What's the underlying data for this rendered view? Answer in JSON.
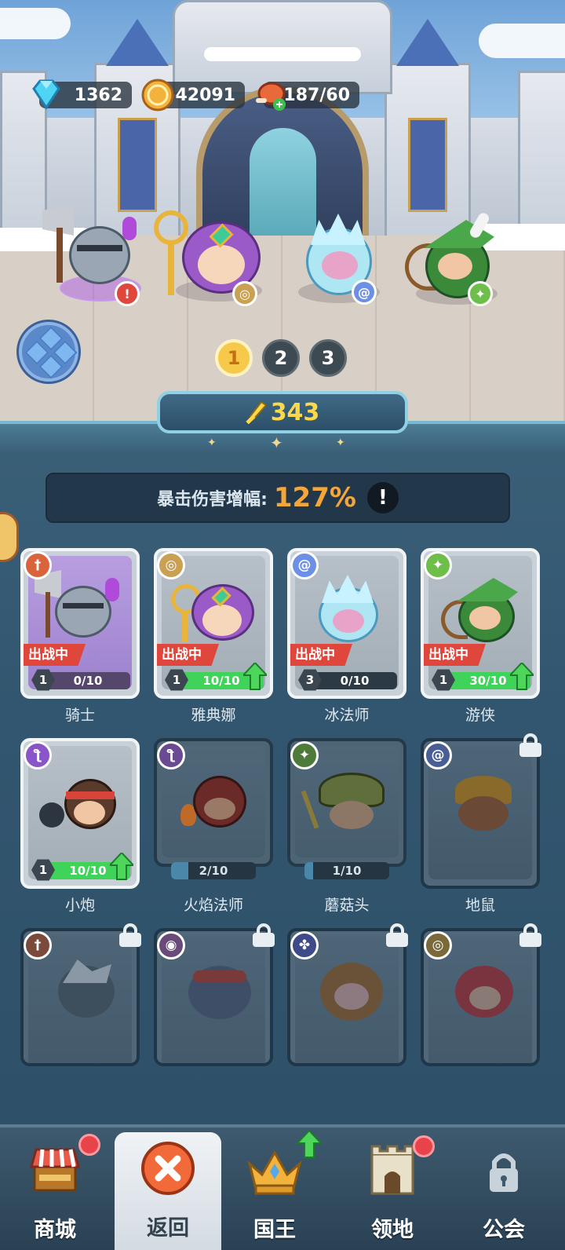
{
  "resources": {
    "gems": "1362",
    "gold": "42091",
    "stamina": "187/60"
  },
  "team_pages": [
    "1",
    "2",
    "3"
  ],
  "active_page": "1",
  "power": "343",
  "crit": {
    "label": "暴击伤害增幅:",
    "value": "127%",
    "info": "!"
  },
  "deploy_tag": "出战中",
  "heroes": [
    {
      "name": "骑士",
      "level": "1",
      "progress": "0/10",
      "deployed": true,
      "upgradable": false,
      "class_color": "#d9643c",
      "fill": 0
    },
    {
      "name": "雅典娜",
      "level": "1",
      "progress": "10/10",
      "deployed": true,
      "upgradable": true,
      "class_color": "#caa052",
      "fill": 1
    },
    {
      "name": "冰法师",
      "level": "3",
      "progress": "0/10",
      "deployed": true,
      "upgradable": false,
      "class_color": "#6d8fe6",
      "fill": 0
    },
    {
      "name": "游侠",
      "level": "1",
      "progress": "30/10",
      "deployed": true,
      "upgradable": true,
      "class_color": "#6ebe4a",
      "fill": 1
    },
    {
      "name": "小炮",
      "level": "1",
      "progress": "10/10",
      "deployed": false,
      "upgradable": true,
      "class_color": "#8a55c8",
      "fill": 1
    },
    {
      "name": "火焰法师",
      "progress": "2/10",
      "class_color": "#8a55c8",
      "fill": 0.2
    },
    {
      "name": "蘑菇头",
      "progress": "1/10",
      "class_color": "#6ebe4a",
      "fill": 0.1
    },
    {
      "name": "地鼠",
      "locked": true,
      "class_color": "#6d8fe6"
    }
  ],
  "locked_row": [
    {
      "class_color": "#d9643c"
    },
    {
      "class_color": "#8a55c8"
    },
    {
      "class_color": "#5a6ac8"
    },
    {
      "class_color": "#caa052"
    }
  ],
  "nav": {
    "shop": "商城",
    "back": "返回",
    "king": "国王",
    "territory": "领地",
    "guild": "公会"
  }
}
